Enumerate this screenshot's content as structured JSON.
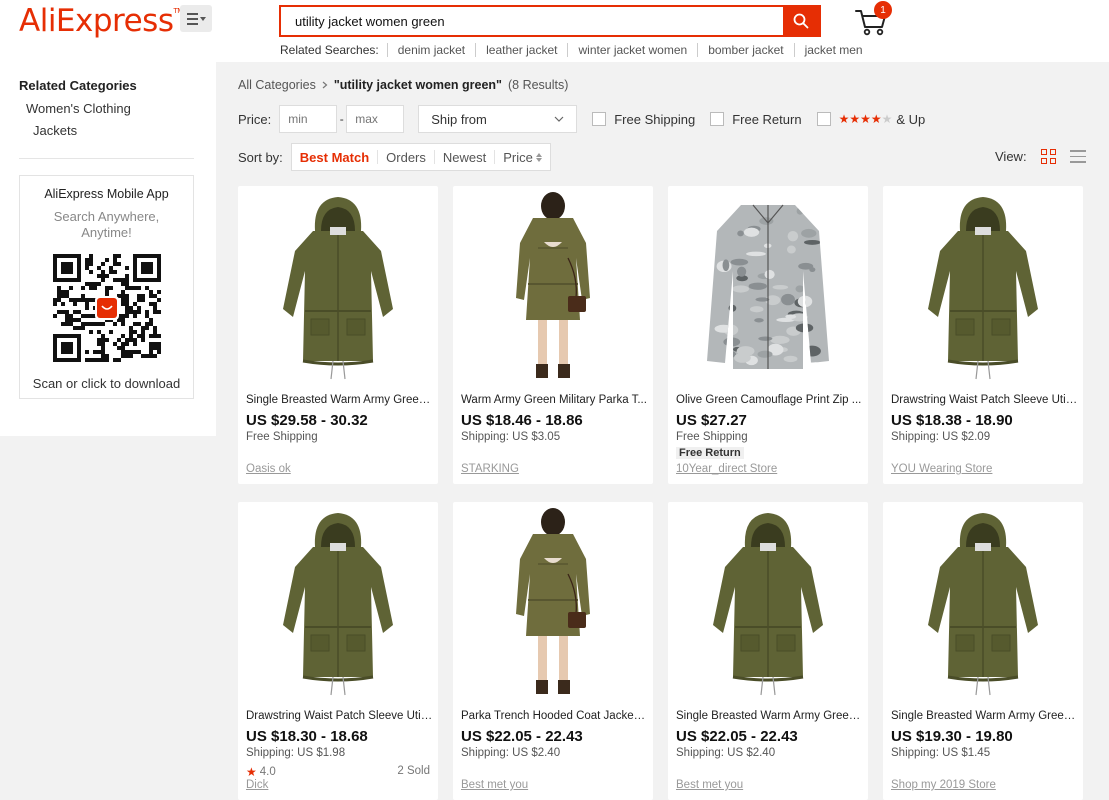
{
  "header": {
    "logo": "AliExpress",
    "logo_tm": "TM",
    "search_value": "utility jacket women green",
    "cart_count": "1",
    "related_label": "Related Searches:",
    "related": [
      "denim jacket",
      "leather jacket",
      "winter jacket women",
      "bomber jacket",
      "jacket men"
    ]
  },
  "sidebar": {
    "title": "Related Categories",
    "items": [
      "Women's Clothing",
      "Jackets"
    ],
    "app_title": "AliExpress Mobile App",
    "app_sub": "Search Anywhere, Anytime!",
    "app_download": "Scan or click to download"
  },
  "breadcrumb": {
    "root": "All Categories",
    "query": "\"utility jacket women green\"",
    "count": "(8 Results)"
  },
  "filters": {
    "price_label": "Price:",
    "min_placeholder": "min",
    "max_placeholder": "max",
    "dash": "-",
    "ship_from": "Ship from",
    "free_shipping": "Free Shipping",
    "free_return": "Free Return",
    "rating_stars": 4,
    "and_up": "& Up"
  },
  "sort": {
    "label": "Sort by:",
    "options": [
      "Best Match",
      "Orders",
      "Newest",
      "Price"
    ],
    "active": "Best Match",
    "view_label": "View:"
  },
  "colors": {
    "accent": "#e62e04",
    "olive": "#5f6335",
    "olive_dark": "#4a4d28"
  },
  "products": [
    {
      "title": "Single Breasted Warm Army Green...",
      "price": "US $29.58 - 30.32",
      "shipping": "Free Shipping",
      "store": "Oasis ok",
      "image": "olive-hooded-parka"
    },
    {
      "title": "Warm Army Green Military Parka T...",
      "price": "US $18.46 - 18.86",
      "shipping": "Shipping: US $3.05",
      "store": "STARKING",
      "image": "model-green-parka"
    },
    {
      "title": "Olive Green Camouflage Print Zip ...",
      "price": "US $27.27",
      "shipping": "Free Shipping",
      "badge": "Free Return",
      "store": "10Year_direct Store",
      "image": "camouflage-jacket"
    },
    {
      "title": "Drawstring Waist Patch Sleeve Utili...",
      "price": "US $18.38 - 18.90",
      "shipping": "Shipping: US $2.09",
      "store": "YOU Wearing Store",
      "image": "olive-hooded-parka"
    },
    {
      "title": "Drawstring Waist Patch Sleeve Utili...",
      "price": "US $18.30 - 18.68",
      "shipping": "Shipping: US $1.98",
      "rating": "4.0",
      "sold": "2 Sold",
      "store": "Dick",
      "image": "olive-hooded-parka"
    },
    {
      "title": "Parka Trench Hooded Coat Jacket ...",
      "price": "US $22.05 - 22.43",
      "shipping": "Shipping: US $2.40",
      "store": "Best met you",
      "image": "model-green-parka"
    },
    {
      "title": "Single Breasted Warm Army Green...",
      "price": "US $22.05 - 22.43",
      "shipping": "Shipping: US $2.40",
      "store": "Best met you",
      "image": "olive-hooded-parka"
    },
    {
      "title": "Single Breasted Warm Army Green...",
      "price": "US $19.30 - 19.80",
      "shipping": "Shipping: US $1.45",
      "store": "Shop my 2019 Store",
      "image": "olive-hooded-parka"
    }
  ]
}
